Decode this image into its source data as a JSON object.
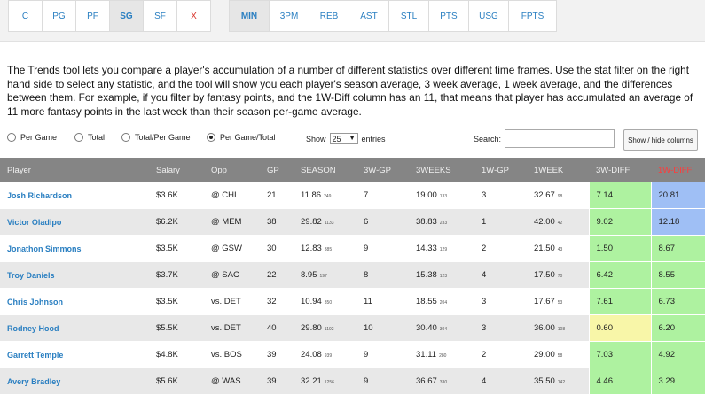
{
  "positions": [
    {
      "label": "C",
      "active": false
    },
    {
      "label": "PG",
      "active": false
    },
    {
      "label": "PF",
      "active": false
    },
    {
      "label": "SG",
      "active": true
    },
    {
      "label": "SF",
      "active": false
    },
    {
      "label": "X",
      "active": false
    }
  ],
  "stats": [
    {
      "label": "MIN",
      "active": true
    },
    {
      "label": "3PM",
      "active": false
    },
    {
      "label": "REB",
      "active": false
    },
    {
      "label": "AST",
      "active": false
    },
    {
      "label": "STL",
      "active": false
    },
    {
      "label": "PTS",
      "active": false
    },
    {
      "label": "USG",
      "active": false
    },
    {
      "label": "FPTS",
      "active": false
    }
  ],
  "description": "The Trends tool lets you compare a player's accumulation of a number of different statistics over different time frames. Use the stat filter on the right hand side to select any statistic, and the tool will show you each player's season average, 3 week average, 1 week average, and the differences between them. For example, if you filter by fantasy points, and the 1W-Diff column has an 11, that means that player has accumulated an average of 11 more fantasy points in the last week than their season per-game average.",
  "radios": [
    {
      "label": "Per Game",
      "checked": false
    },
    {
      "label": "Total",
      "checked": false
    },
    {
      "label": "Total/Per Game",
      "checked": false
    },
    {
      "label": "Per Game/Total",
      "checked": true
    }
  ],
  "show_label": "Show",
  "entries_value": "25",
  "entries_label": "entries",
  "search_label": "Search:",
  "search_value": "",
  "showhide_label": "Show / hide columns",
  "columns": [
    "Player",
    "Salary",
    "Opp",
    "GP",
    "SEASON",
    "3W-GP",
    "3WEEKS",
    "1W-GP",
    "1WEEK",
    "3W-DIFF",
    "1W-DIFF"
  ],
  "rows": [
    {
      "player": "Josh Richardson",
      "salary": "$3.6K",
      "opp": "@ CHI",
      "gp": "21",
      "season": "11.86",
      "season_sub": "249",
      "gp3": "7",
      "weeks3": "19.00",
      "weeks3_sub": "133",
      "gp1": "3",
      "week1": "32.67",
      "week1_sub": "98",
      "diff3": "7.14",
      "diff3_color": "green",
      "diff1": "20.81",
      "diff1_color": "blue"
    },
    {
      "player": "Victor Oladipo",
      "salary": "$6.2K",
      "opp": "@ MEM",
      "gp": "38",
      "season": "29.82",
      "season_sub": "1133",
      "gp3": "6",
      "weeks3": "38.83",
      "weeks3_sub": "233",
      "gp1": "1",
      "week1": "42.00",
      "week1_sub": "42",
      "diff3": "9.02",
      "diff3_color": "green",
      "diff1": "12.18",
      "diff1_color": "blue"
    },
    {
      "player": "Jonathon Simmons",
      "salary": "$3.5K",
      "opp": "@ GSW",
      "gp": "30",
      "season": "12.83",
      "season_sub": "385",
      "gp3": "9",
      "weeks3": "14.33",
      "weeks3_sub": "129",
      "gp1": "2",
      "week1": "21.50",
      "week1_sub": "43",
      "diff3": "1.50",
      "diff3_color": "green",
      "diff1": "8.67",
      "diff1_color": "green"
    },
    {
      "player": "Troy Daniels",
      "salary": "$3.7K",
      "opp": "@ SAC",
      "gp": "22",
      "season": "8.95",
      "season_sub": "197",
      "gp3": "8",
      "weeks3": "15.38",
      "weeks3_sub": "123",
      "gp1": "4",
      "week1": "17.50",
      "week1_sub": "70",
      "diff3": "6.42",
      "diff3_color": "green",
      "diff1": "8.55",
      "diff1_color": "green"
    },
    {
      "player": "Chris Johnson",
      "salary": "$3.5K",
      "opp": "vs. DET",
      "gp": "32",
      "season": "10.94",
      "season_sub": "350",
      "gp3": "11",
      "weeks3": "18.55",
      "weeks3_sub": "204",
      "gp1": "3",
      "week1": "17.67",
      "week1_sub": "53",
      "diff3": "7.61",
      "diff3_color": "green",
      "diff1": "6.73",
      "diff1_color": "green"
    },
    {
      "player": "Rodney Hood",
      "salary": "$5.5K",
      "opp": "vs. DET",
      "gp": "40",
      "season": "29.80",
      "season_sub": "1192",
      "gp3": "10",
      "weeks3": "30.40",
      "weeks3_sub": "304",
      "gp1": "3",
      "week1": "36.00",
      "week1_sub": "108",
      "diff3": "0.60",
      "diff3_color": "yellow",
      "diff1": "6.20",
      "diff1_color": "green"
    },
    {
      "player": "Garrett Temple",
      "salary": "$4.8K",
      "opp": "vs. BOS",
      "gp": "39",
      "season": "24.08",
      "season_sub": "939",
      "gp3": "9",
      "weeks3": "31.11",
      "weeks3_sub": "280",
      "gp1": "2",
      "week1": "29.00",
      "week1_sub": "58",
      "diff3": "7.03",
      "diff3_color": "green",
      "diff1": "4.92",
      "diff1_color": "green"
    },
    {
      "player": "Avery Bradley",
      "salary": "$5.6K",
      "opp": "@ WAS",
      "gp": "39",
      "season": "32.21",
      "season_sub": "1256",
      "gp3": "9",
      "weeks3": "36.67",
      "weeks3_sub": "330",
      "gp1": "4",
      "week1": "35.50",
      "week1_sub": "142",
      "diff3": "4.46",
      "diff3_color": "green",
      "diff1": "3.29",
      "diff1_color": "green"
    }
  ]
}
